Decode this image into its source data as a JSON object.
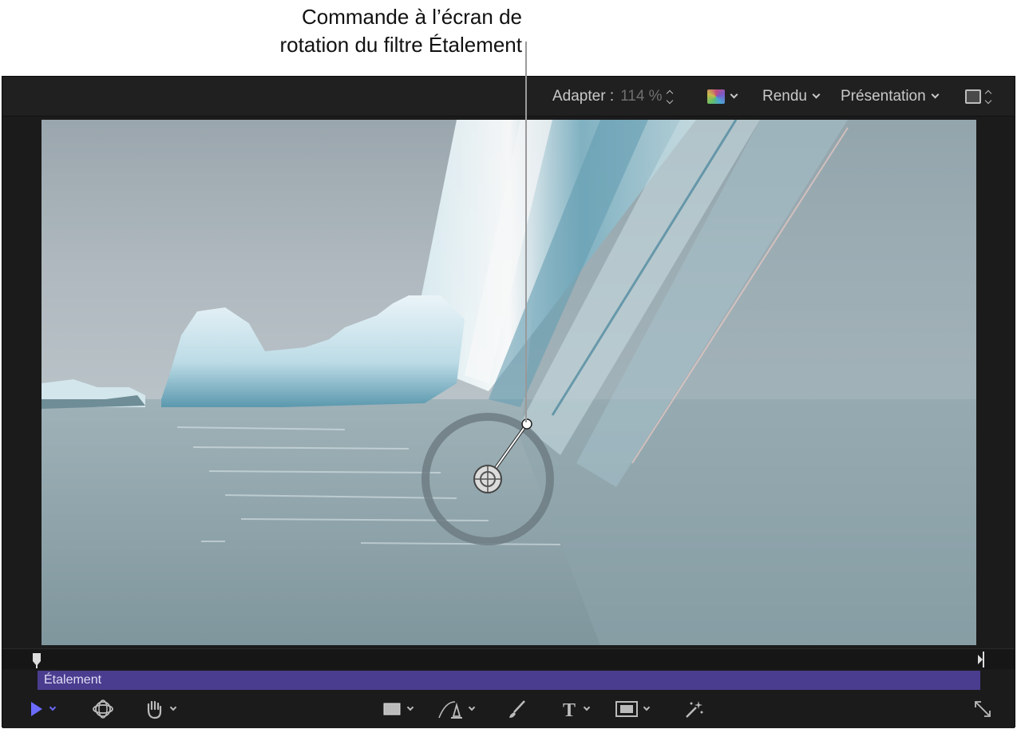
{
  "callout": {
    "line1": "Commande à l’écran de",
    "line2": "rotation du filtre Étalement"
  },
  "toolbar": {
    "fit_label": "Adapter :",
    "fit_value": "114 %",
    "color_menu": "color-channels-icon",
    "render_label": "Rendu",
    "view_label": "Présentation",
    "layout_menu": "square-layout-icon"
  },
  "canvas": {
    "image": "iceberg with streaked smear effect on water",
    "onscreen_control": "rotation-handle"
  },
  "timeline": {
    "clip_label": "Étalement"
  },
  "tools": [
    {
      "name": "select-tool",
      "icon": "arrow-icon",
      "has_menu": true
    },
    {
      "name": "3d-transform-tool",
      "icon": "orbit-icon",
      "has_menu": false
    },
    {
      "name": "pan-tool",
      "icon": "hand-icon",
      "has_menu": true
    },
    {
      "name": "shape-tool",
      "icon": "rectangle-icon",
      "has_menu": true
    },
    {
      "name": "bezier-tool",
      "icon": "pen-icon",
      "has_menu": true
    },
    {
      "name": "paint-tool",
      "icon": "brush-icon",
      "has_menu": false
    },
    {
      "name": "text-tool",
      "icon": "text-icon",
      "has_menu": true
    },
    {
      "name": "mask-tool",
      "icon": "mask-icon",
      "has_menu": true
    },
    {
      "name": "generator-tool",
      "icon": "magic-wand-icon",
      "has_menu": false
    },
    {
      "name": "fullscreen-toggle",
      "icon": "expand-icon",
      "has_menu": false
    }
  ],
  "colors": {
    "accent_purple": "#4a3d8f",
    "select_tool_blue": "#6b6bff"
  }
}
